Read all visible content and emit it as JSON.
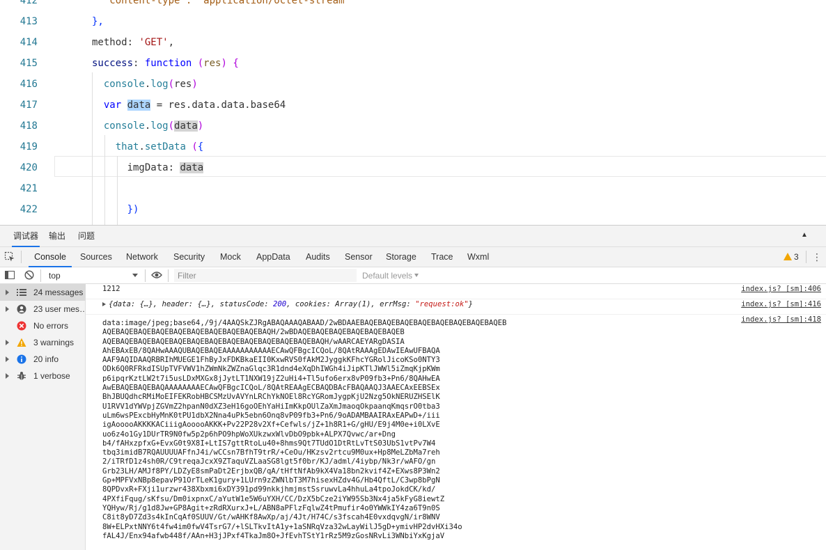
{
  "editor": {
    "lines": [
      {
        "num": "412",
        "segments": [
          {
            "t": "  'content-type': 'application/octet-stream'",
            "c": "c-str2"
          }
        ]
      },
      {
        "num": "413",
        "segments": [
          {
            "t": "},",
            "c": "c-brace"
          }
        ]
      },
      {
        "num": "414",
        "segments": [
          {
            "t": "method",
            "c": "c-punct"
          },
          {
            "t": ": ",
            "c": "c-punct"
          },
          {
            "t": "'GET'",
            "c": "c-str"
          },
          {
            "t": ",",
            "c": "c-punct"
          }
        ]
      },
      {
        "num": "415",
        "segments": [
          {
            "t": "success",
            "c": "c-key"
          },
          {
            "t": ": ",
            "c": "c-punct"
          },
          {
            "t": "function",
            "c": "c-kw"
          },
          {
            "t": " (",
            "c": "c-paren-y"
          },
          {
            "t": "res",
            "c": "c-fn"
          },
          {
            "t": ") {",
            "c": "c-paren-y"
          }
        ]
      },
      {
        "num": "416",
        "segments": [
          {
            "t": "  console",
            "c": "c-obj"
          },
          {
            "t": ".",
            "c": "c-punct"
          },
          {
            "t": "log",
            "c": "c-obj"
          },
          {
            "t": "(",
            "c": "c-paren-y"
          },
          {
            "t": "res",
            "c": "c-punct"
          },
          {
            "t": ")",
            "c": "c-paren-y"
          }
        ]
      },
      {
        "num": "417",
        "segments": [
          {
            "t": "  var",
            "c": "c-kw"
          },
          {
            "t": " ",
            "c": "c-punct"
          },
          {
            "t": "data",
            "c": "c-punct",
            "hl": "hl-sel"
          },
          {
            "t": " = res.data.data.base64",
            "c": "c-punct"
          }
        ]
      },
      {
        "num": "418",
        "segments": [
          {
            "t": "  console",
            "c": "c-obj"
          },
          {
            "t": ".",
            "c": "c-punct"
          },
          {
            "t": "log",
            "c": "c-obj"
          },
          {
            "t": "(",
            "c": "c-paren-y"
          },
          {
            "t": "data",
            "c": "c-punct",
            "hl": "hl-occ"
          },
          {
            "t": ")",
            "c": "c-paren-y"
          }
        ]
      },
      {
        "num": "419",
        "segments": [
          {
            "t": "    that",
            "c": "c-obj"
          },
          {
            "t": ".",
            "c": "c-punct"
          },
          {
            "t": "setData",
            "c": "c-obj"
          },
          {
            "t": " (",
            "c": "c-paren-y"
          },
          {
            "t": "{",
            "c": "c-brace"
          }
        ]
      },
      {
        "num": "420",
        "segments": [
          {
            "t": "      imgData",
            "c": "c-punct"
          },
          {
            "t": ": ",
            "c": "c-punct"
          },
          {
            "t": "data",
            "c": "c-punct",
            "hl": "hl-occ"
          }
        ]
      },
      {
        "num": "421",
        "segments": []
      },
      {
        "num": "422",
        "segments": [
          {
            "t": "      })",
            "c": "c-brace"
          }
        ]
      }
    ]
  },
  "panel_tabs": [
    "调试器",
    "输出",
    "问题"
  ],
  "tool_tabs": [
    "Console",
    "Sources",
    "Network",
    "Security",
    "Mock",
    "AppData",
    "Audits",
    "Sensor",
    "Storage",
    "Trace",
    "Wxml"
  ],
  "warnings_count": "3",
  "filter_bar": {
    "context": "top",
    "filter_placeholder": "Filter",
    "levels": "Default levels"
  },
  "sidebar": {
    "items": [
      {
        "label": "24 messages",
        "icon": "list-icon"
      },
      {
        "label": "23 user mes…",
        "icon": "user-icon"
      },
      {
        "label": "No errors",
        "icon": "error-icon"
      },
      {
        "label": "3 warnings",
        "icon": "warning-icon"
      },
      {
        "label": "20 info",
        "icon": "info-icon"
      },
      {
        "label": "1 verbose",
        "icon": "bug-icon"
      }
    ]
  },
  "console": {
    "messages": [
      {
        "text": "1212",
        "source": "index.js? [sm]:406"
      },
      {
        "obj": {
          "prefix": "{data: {…}, header: {…}, statusCode: ",
          "status": "200",
          "mid": ", cookies: Array(1), errMsg: ",
          "errmsg": "\"request:ok\"",
          "suffix": "}"
        },
        "source": "index.js? [sm]:416"
      },
      {
        "base64_lines": [
          "data:image/jpeg;base64,/9j/4AAQSkZJRgABAQAAAQABAAD/2wBDAAEBAQEBAQEBAQEBAQEBAQEBAQEBAQEBAQEB",
          "AQEBAQEBAQEBAQEBAQEBAQEBAQEBAQEBAQEBAQH/2wBDAQEBAQEBAQEBAQEBAQEBAQEB",
          "AQEBAQEBAQEBAQEBAQEBAQEBAQEBAQEBAQEBAQEBAQEBAQEBAQH/wAARCAEYARgDASIA",
          "AhEBAxEB/8QAHwAAAQUBAQEBAQEAAAAAAAAAAAECAwQFBgcICQoL/8QAtRAAAgEDAwIEAwUFBAQA",
          "AAF9AQIDAAQRBRIhMUEGE1FhByJxFDKBkaEII0KxwRVS0fAkM2JyggkKFhcYGRolJicoKSo0NTY3",
          "ODk6Q0RFRkdISUpTVFVWV1hZWmNkZWZnaGlqc3R1dnd4eXqDhIWGh4iJipKTlJWWl5iZmqKjpKWm",
          "p6ipqrKztLW2t7i5usLDxMXGx8jJytLT1NXW19jZ2uHi4+Tl5ufo6erx8vP09fb3+Pn6/8QAHwEA",
          "AwEBAQEBAQEBAQAAAAAAAAECAwQFBgcICQoL/8QAtREAAgECBAQDBAcFBAQAAQJ3AAECAxEEBSEx",
          "BhJBUQdhcRMiMoEIFEKRobHBCSMzUvAVYnLRChYkNOEl8RcYGRomJygpKjU2Nzg5OkNERUZHSElK",
          "U1RVV1dYWVpjZGVmZ2hpanN0dXZ3eH16goOEhYaHiImKkpOUlZaXmJmaoqOkpaanqKmqsrO0tba3",
          "uLm6wsPExcbHyMnK0tPU1dbX2Nna4uPk5ebn6Onq8vP09fb3+Pn6/9oADAMBAAIRAxEAPwD+/iii",
          "igAooooAKKKKACiiigAooooAKKK+Pv22P28v2Xf+Cefwls/jZ+1h8R1+G/gHU/E9j4M0e+i0LXvE",
          "uo6z4o1Gy1DUrTR9N0fw5p2p6hPO9hpWoXUkzwxWlvDbO9pbk+ALPX7Qvwc/ar+Dng",
          "b4/fAHxzpfxG+EvxG0t9X8I+LtIS7gttRtoLu40+8hms9Qt7TUdO1DtRtLvTtS03UbS1vtPv7W4",
          "tbq3imidB7RQAUUUUAFfnJ4i/wCCsn7BfhT9trR/+CeOu/HKzsv2rtcu9M0ux+Hp8MeLZbMa7reh",
          "2/iTRfD1z4sh0R/C9treqaJcxX9ZTaquVZLaaSG8lgt5f0br/KJ/adml/4iybp/Nk3r/wAFO/gn",
          "Grb23LH/AMJf8PY/LDZyE8smPaDt2ErjbxQB/qA/tHftNfAb9kX4Va18bn2kvif4Z+EXws8P3Wn2",
          "Gp+MPFVxNBp8epavP91OrTLeK1gury+1LUrn9zZWNlbT3M7hisexHZdv4G/Hb4QftL/C3wp8bPgN",
          "8QPDvxR+FXji1urzwr438Xbxmi6xDY391pd99nkkjhmjmstSsruwvLa4hhuLa4tpoJokdCK/kd/",
          "4PXfiFqug/sKfsu/Dm0ixpnxC/aYutW1e5W6uYXH/CC/DzX5bCze2iYW95Sb3Nx4ja5kFyG8iewtZ",
          "YQHyw/Rj/g1d8Jw+GP8Agit+zRdRXurxJ+L/ABN8aPFlzFqlwZ4tPmufir4o0YWWkIY4za6T9n0S",
          "C8it8yD7Zd3s4kInCqAf0SUUV/Gt/wAHKf8AwXp/aj/4Jt/H74C/s3fscah4E0vxdqvgN/ir8WNV",
          "8W+ELPxtNNY6t4fw4im0fwV4TsrG7/+lSLTkvItA1y+1aSNRqVza32wLayWilJ5gD+ymivHP2dvHXi34o",
          "fAL4J/Enx94afwb448f/AAn+H3jJPxf4TkaJm8O+JfEvhTStY1rRz5M9zGosNRvLi3WNbiYxKgjaV"
        ],
        "source": "index.js? [sm]:418"
      }
    ]
  }
}
